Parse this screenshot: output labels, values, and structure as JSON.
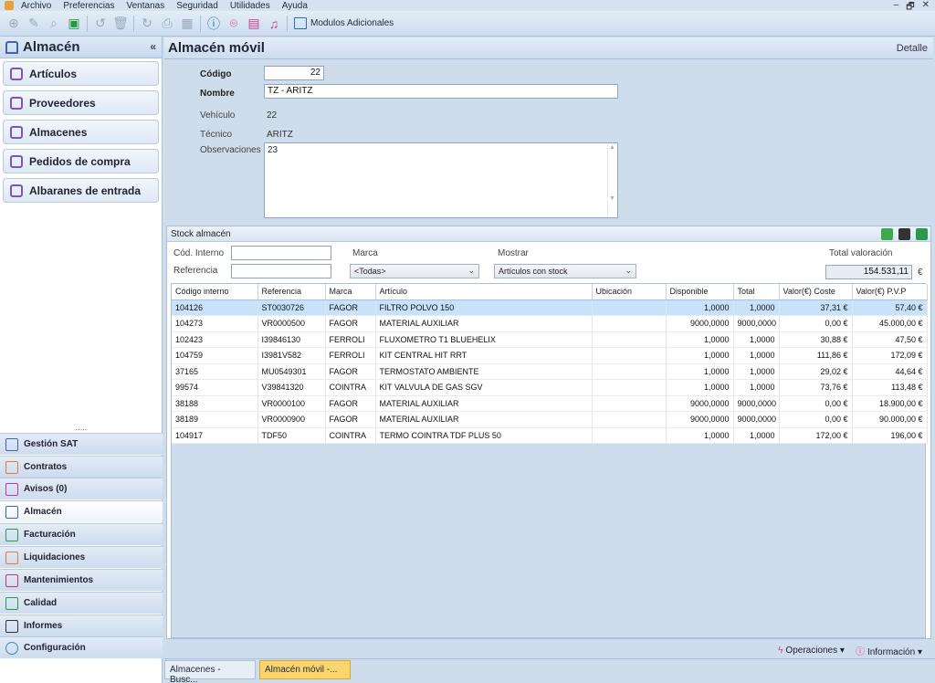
{
  "menu": [
    "Archivo",
    "Preferencias",
    "Ventanas",
    "Seguridad",
    "Utilidades",
    "Ayuda"
  ],
  "window_controls": [
    "–",
    "🗗",
    "✕"
  ],
  "toolbar": {
    "modulos_label": "Modulos Adicionales"
  },
  "left": {
    "title": "Almacén",
    "collapse": "«",
    "nav": [
      {
        "label": "Artículos",
        "icon": "cube-icon"
      },
      {
        "label": "Proveedores",
        "icon": "people-icon"
      },
      {
        "label": "Almacenes",
        "icon": "warehouse-icon"
      },
      {
        "label": "Pedidos de compra",
        "icon": "clipboard-icon"
      },
      {
        "label": "Albaranes de entrada",
        "icon": "document-icon"
      }
    ],
    "splitter": ".....",
    "modules": [
      {
        "label": "Gestión SAT",
        "color": "#3d66b0"
      },
      {
        "label": "Contratos",
        "color": "#e07a3a"
      },
      {
        "label": "Avisos (0)",
        "color": "#c03a9a"
      },
      {
        "label": "Almacén",
        "color": "#3d66b0"
      },
      {
        "label": "Facturación",
        "color": "#2a9a4a"
      },
      {
        "label": "Liquidaciones",
        "color": "#e07a3a"
      },
      {
        "label": "Mantenimientos",
        "color": "#c03a6a"
      },
      {
        "label": "Calidad",
        "color": "#2a9a4a"
      },
      {
        "label": "Informes",
        "color": "#333333"
      },
      {
        "label": "Configuración",
        "color": "#3d86c6"
      }
    ]
  },
  "header": {
    "title": "Almacén móvil",
    "detail": "Detalle"
  },
  "form": {
    "codigo_label": "Código",
    "codigo": "22",
    "nombre_label": "Nombre",
    "nombre": "TZ - ARITZ",
    "vehiculo_label": "Vehículo",
    "vehiculo": "22",
    "tecnico_label": "Técnico",
    "tecnico": "ARITZ",
    "obs_label": "Observaciones",
    "obs": "23"
  },
  "stock": {
    "title": "Stock almacén",
    "cod_label": "Cód. Interno",
    "ref_label": "Referencia",
    "marca_label": "Marca",
    "marca": "<Todas>",
    "mostrar_label": "Mostrar",
    "mostrar": "Artículos con stock",
    "total_label": "Total valoración",
    "total": "154.531,11",
    "currency": "€",
    "columns": [
      "Código interno",
      "Referencia",
      "Marca",
      "Artículo",
      "Ubicación",
      "Disponible",
      "Total",
      "Valor(€) Coste",
      "Valor(€) P.V.P"
    ],
    "rows": [
      [
        "104126",
        "ST0030726",
        "FAGOR",
        "FILTRO POLVO 150",
        "",
        "1,0000",
        "1,0000",
        "37,31 €",
        "57,40 €"
      ],
      [
        "104273",
        "VR0000500",
        "FAGOR",
        "MATERIAL AUXILIAR",
        "",
        "9000,0000",
        "9000,0000",
        "0,00 €",
        "45.000,00 €"
      ],
      [
        "102423",
        "I39846130",
        "FERROLI",
        "FLUXOMETRO T1 BLUEHELIX",
        "",
        "1,0000",
        "1,0000",
        "30,88 €",
        "47,50 €"
      ],
      [
        "104759",
        "I3981V582",
        "FERROLI",
        "KIT CENTRAL HIT RRT",
        "",
        "1,0000",
        "1,0000",
        "111,86 €",
        "172,09 €"
      ],
      [
        "37165",
        "MU0549301",
        "FAGOR",
        "TERMOSTATO AMBIENTE",
        "",
        "1,0000",
        "1,0000",
        "29,02 €",
        "44,64 €"
      ],
      [
        "99574",
        "V39841320",
        "COINTRA",
        "KIT VALVULA DE GAS SGV",
        "",
        "1,0000",
        "1,0000",
        "73,76 €",
        "113,48 €"
      ],
      [
        "38188",
        "VR0000100",
        "FAGOR",
        "MATERIAL AUXILIAR",
        "",
        "9000,0000",
        "9000,0000",
        "0,00 €",
        "18.900,00 €"
      ],
      [
        "38189",
        "VR0000900",
        "FAGOR",
        "MATERIAL AUXILIAR",
        "",
        "9000,0000",
        "9000,0000",
        "0,00 €",
        "90.000,00 €"
      ],
      [
        "104917",
        "TDF50",
        "COINTRA",
        "TERMO COINTRA TDF PLUS 50",
        "",
        "1,0000",
        "1,0000",
        "172,00 €",
        "196,00 €"
      ]
    ]
  },
  "status": {
    "operaciones": "Operaciones",
    "informacion": "Información",
    "caret": "▾"
  },
  "tabs": [
    {
      "label": "Almacenes - Busc..."
    },
    {
      "label": "Almacén móvil -..."
    }
  ]
}
